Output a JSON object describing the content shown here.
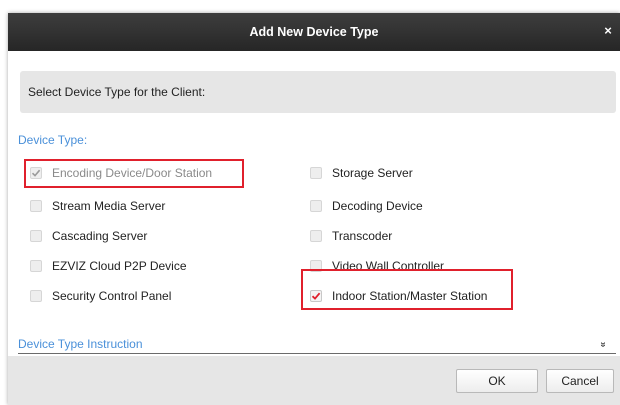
{
  "dialog": {
    "title": "Add New Device Type",
    "close_glyph": "×",
    "prompt": "Select Device Type for the Client:",
    "section_label": "Device Type:",
    "instruction_label": "Device Type Instruction",
    "expand_glyph": "»",
    "ok_label": "OK",
    "cancel_label": "Cancel"
  },
  "device_types": {
    "left": [
      {
        "label": "Encoding Device/Door Station",
        "checked": true,
        "disabled": true,
        "highlighted": true
      },
      {
        "label": "Stream Media Server",
        "checked": false
      },
      {
        "label": "Cascading Server",
        "checked": false
      },
      {
        "label": "EZVIZ Cloud P2P Device",
        "checked": false
      },
      {
        "label": "Security Control Panel",
        "checked": false
      }
    ],
    "right": [
      {
        "label": "Storage Server",
        "checked": false
      },
      {
        "label": "Decoding Device",
        "checked": false
      },
      {
        "label": "Transcoder",
        "checked": false
      },
      {
        "label": "Video Wall Controller",
        "checked": false
      },
      {
        "label": "Indoor Station/Master Station",
        "checked": true,
        "highlighted": true
      }
    ]
  },
  "colors": {
    "title_bar": "#2f2f2f",
    "accent_blue": "#4a90d9",
    "highlight_red": "#e0202c",
    "checked_red": "#e0202c",
    "checked_gray": "#9a9a9a"
  },
  "icons": {
    "close": "close-icon",
    "expand": "double-chevron-down-icon",
    "checkbox_checked": "checkmark-icon"
  }
}
